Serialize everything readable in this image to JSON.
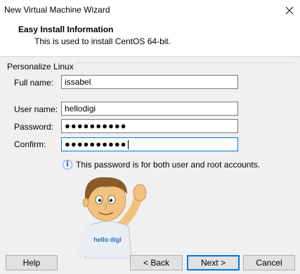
{
  "window": {
    "title": "New Virtual Machine Wizard"
  },
  "header": {
    "title": "Easy Install Information",
    "subtitle": "This is used to install CentOS 64-bit."
  },
  "personalize": {
    "legend": "Personalize Linux",
    "full_name_label": "Full name:",
    "full_name_value": "issabel",
    "user_name_label": "User name:",
    "user_name_value": "hellodigi",
    "password_label": "Password:",
    "password_value": "●●●●●●●●●●",
    "confirm_label": "Confirm:",
    "confirm_value": "●●●●●●●●●●"
  },
  "info": {
    "icon": "info-icon",
    "text": "This password is for both user and root accounts."
  },
  "mascot": {
    "shirt_text": "hello digi"
  },
  "buttons": {
    "help": "Help",
    "back": "< Back",
    "next": "Next >",
    "cancel": "Cancel"
  }
}
